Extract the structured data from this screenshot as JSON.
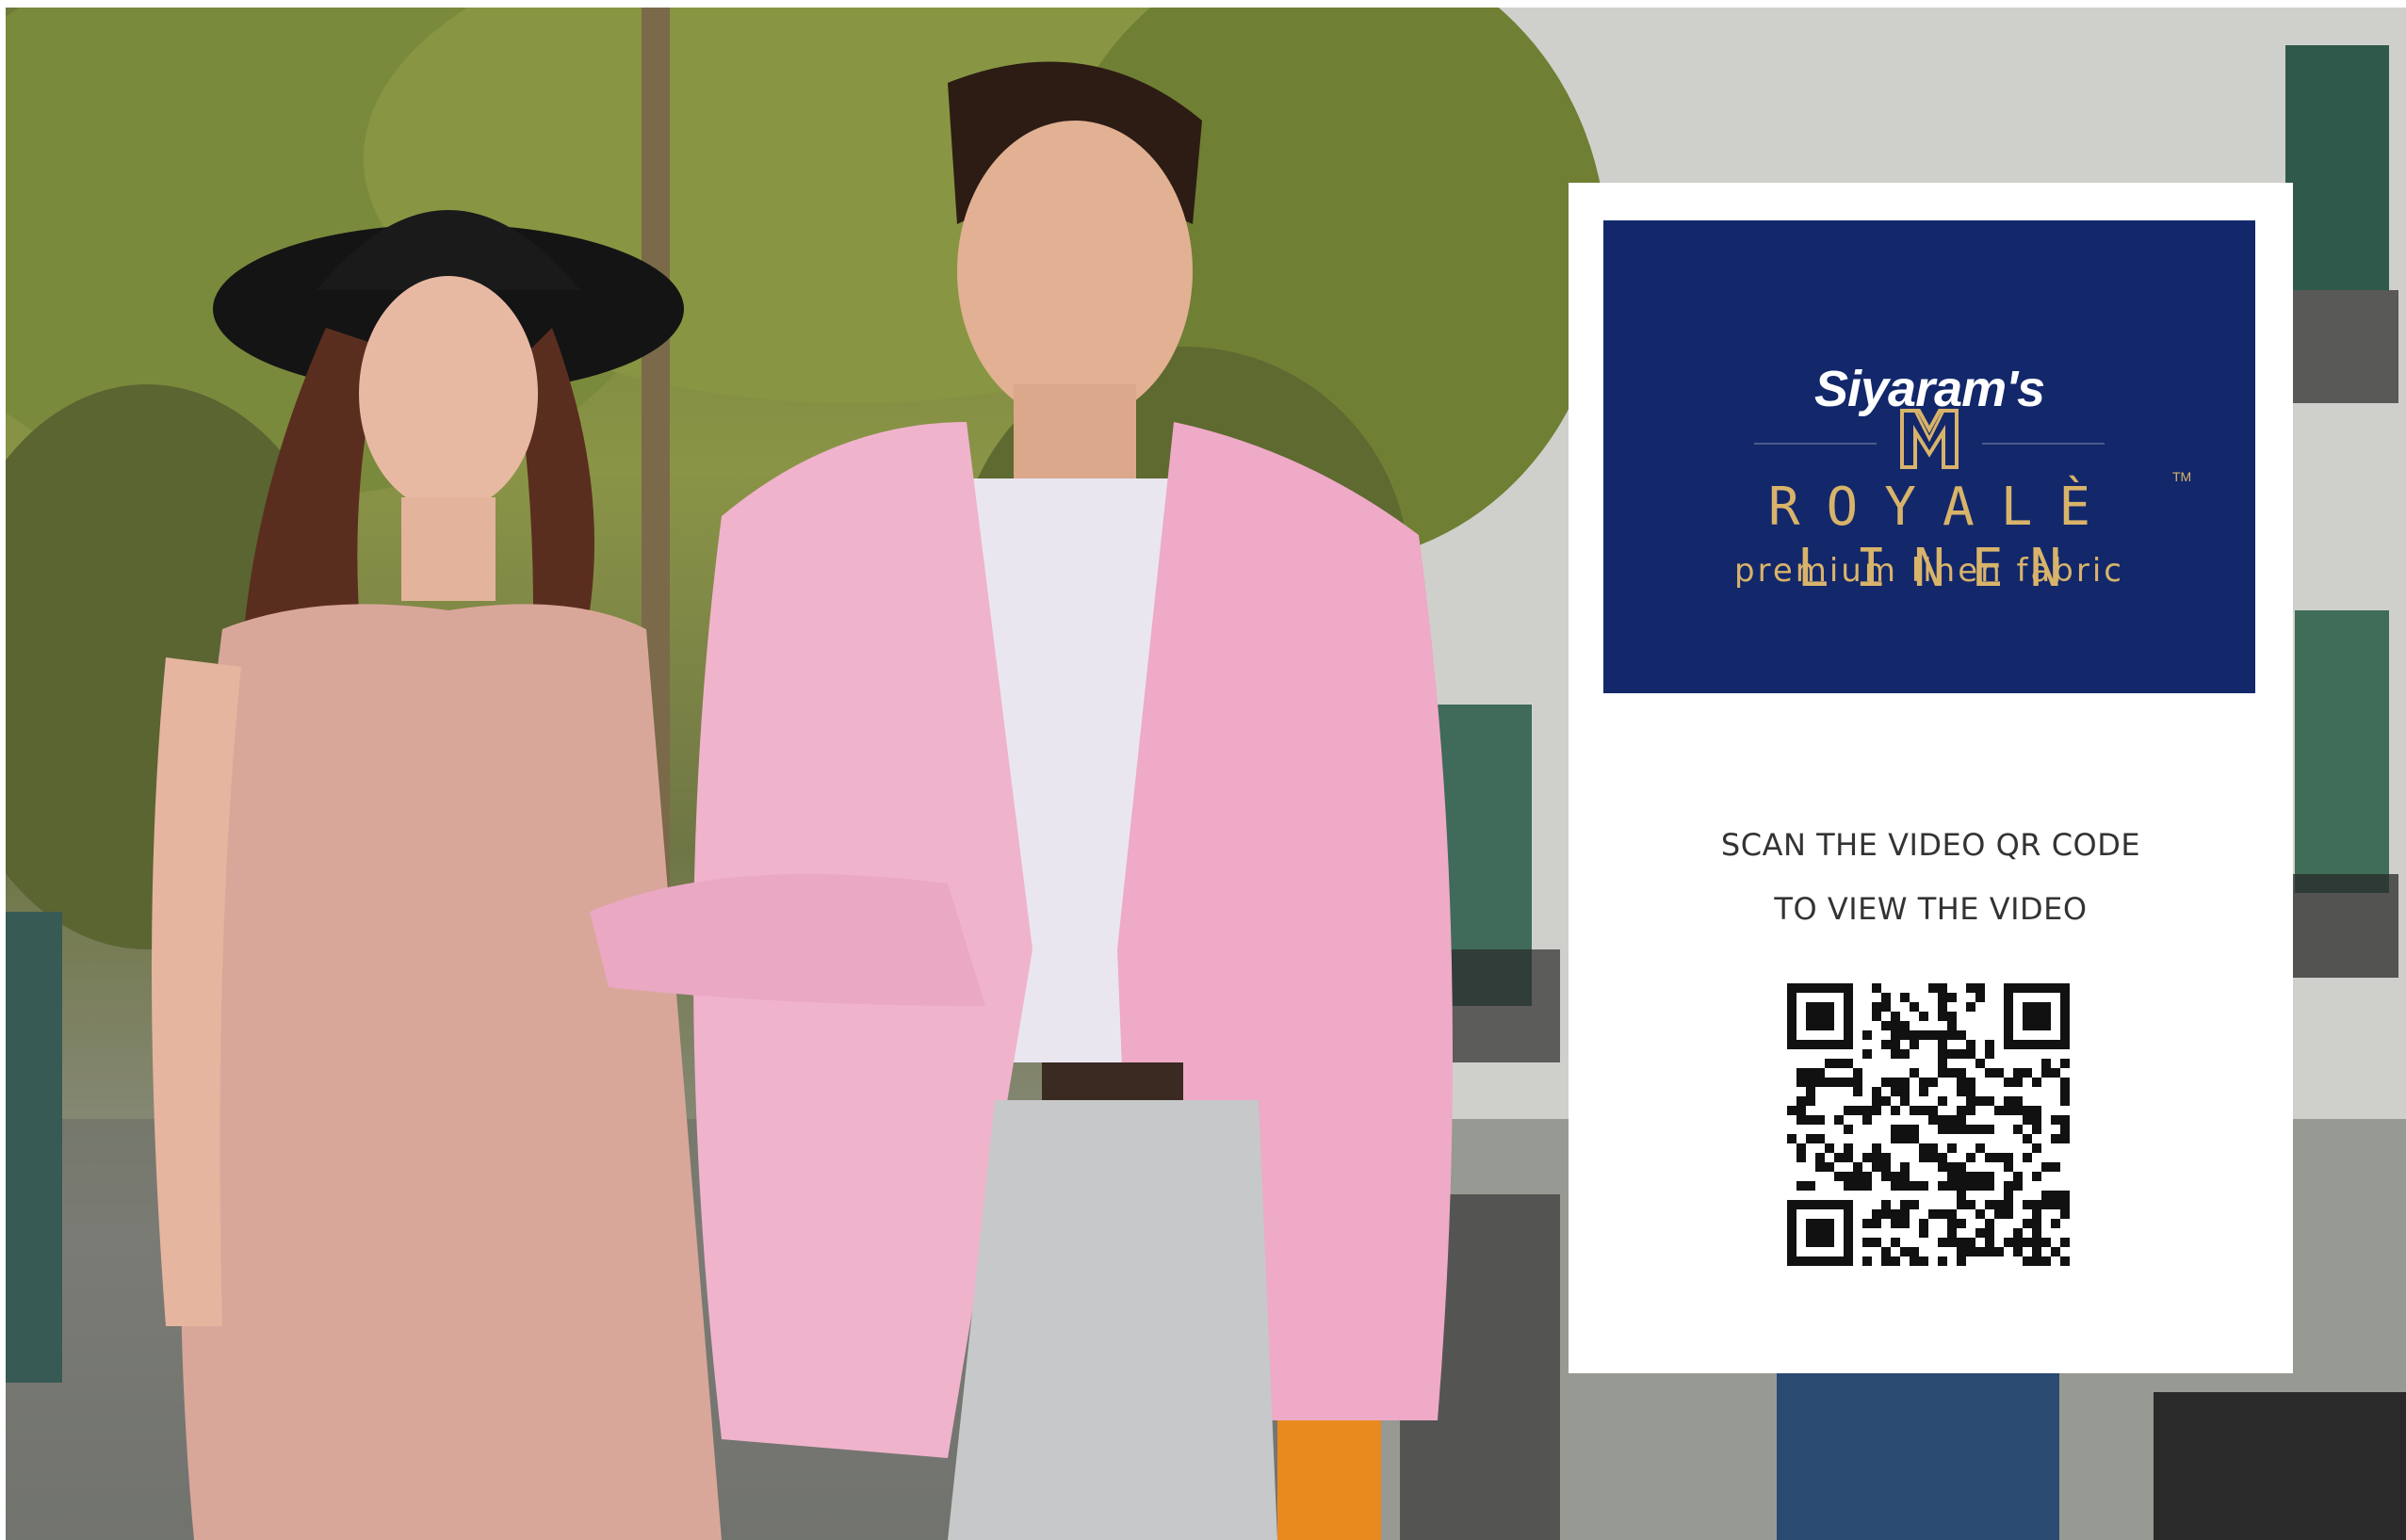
{
  "brand": {
    "name": "Siyaram's",
    "collection": "ROYALÈ LINEN",
    "trademark": "TM",
    "tagline": "premium linen fabric"
  },
  "cta": {
    "line1": "SCAN THE VIDEO QR CODE",
    "line2": "TO VIEW THE VIDEO"
  },
  "colors": {
    "panel": "#13286b",
    "gold": "#d8b36a",
    "accent": "#e0263a"
  }
}
